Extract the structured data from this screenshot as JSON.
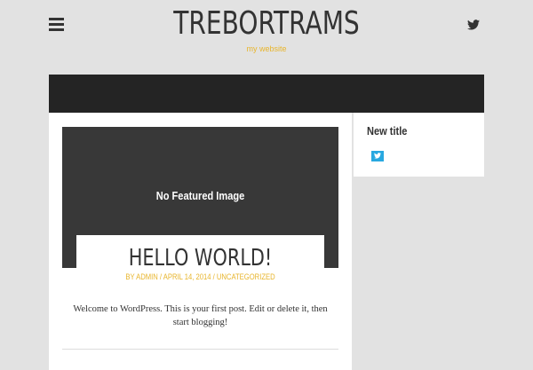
{
  "header": {
    "site_title": "TREBORTRAMS",
    "tagline": "my website",
    "menu_icon": "hamburger-menu-icon",
    "social_icon": "twitter-icon"
  },
  "post": {
    "featured_placeholder": "No Featured Image",
    "title": "HELLO WORLD!",
    "meta_by": "BY ",
    "meta_author": "ADMIN",
    "meta_sep": " / ",
    "meta_date": "APRIL 14, 2014",
    "meta_category": "UNCATEGORIZED",
    "excerpt": "Welcome to WordPress. This is your first post. Edit or delete it, then start blogging!"
  },
  "sidebar": {
    "widget_title": "New title",
    "widget_icon": "twitter-icon"
  },
  "colors": {
    "background": "#e2e2e2",
    "accent": "#e8b52c",
    "dark_bar": "#242424",
    "featured_bg": "#383838",
    "twitter_blue": "#28a8e0"
  }
}
